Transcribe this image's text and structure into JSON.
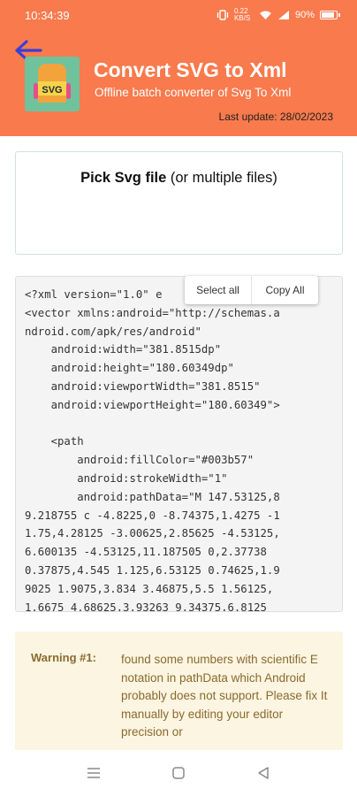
{
  "status_bar": {
    "time": "10:34:39",
    "speed": "0.22 KB/S",
    "battery": "90%"
  },
  "header": {
    "back_icon": "back-arrow-icon",
    "title": "Convert SVG to Xml",
    "subtitle": "Offline batch converter of Svg To Xml",
    "last_update": "Last update: 28/02/2023",
    "logo_text": "SVG",
    "colors": {
      "background": "#f97a4d",
      "logo": "#6fc29c"
    }
  },
  "pick": {
    "bold_label": "Pick Svg file",
    "rest_label": " (or multiple files)"
  },
  "context_menu": {
    "select_all": "Select all",
    "copy_all": "Copy All"
  },
  "code_output": "<?xml version=\"1.0\" e         \"?>\n<vector xmlns:android=\"http://schemas.a\nndroid.com/apk/res/android\"\n    android:width=\"381.8515dp\"\n    android:height=\"180.60349dp\"\n    android:viewportWidth=\"381.8515\"\n    android:viewportHeight=\"180.60349\">\n\n    <path\n        android:fillColor=\"#003b57\"\n        android:strokeWidth=\"1\"\n        android:pathData=\"M 147.53125,8\n9.218755 c -4.8225,0 -8.74375,1.4275 -1\n1.75,4.28125 -3.00625,2.85625 -4.53125,\n6.600135 -4.53125,11.187505 0,2.37738\n0.37875,4.545 1.125,6.53125 0.74625,1.9\n9025 1.9075,3.834 3.46875,5.5 1.56125,\n1.6675 4.68625,3.93263 9.34375,6.8125",
  "warning": {
    "label": "Warning #1:",
    "text": "found some numbers with scientific E notation in pathData which Android probably does not support. Please fix It manually by editing your editor precision or"
  },
  "nav": {
    "menu_icon": "menu-icon",
    "home_icon": "home-icon",
    "back_icon": "back-icon"
  }
}
